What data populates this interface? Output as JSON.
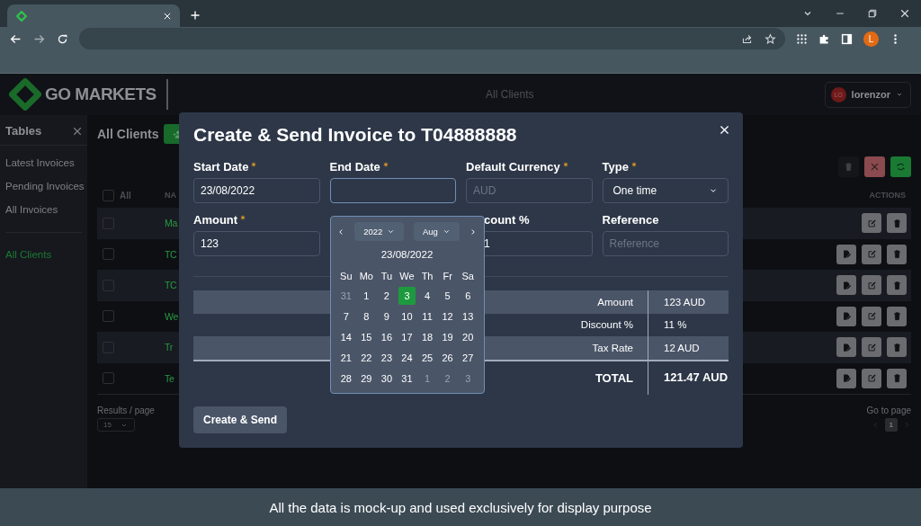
{
  "browser": {
    "profile_initial": "L"
  },
  "header": {
    "logo": "GO MARKETS",
    "title": "All Clients",
    "user": {
      "initials": "LO",
      "name": "lorenzor"
    }
  },
  "sidebar": {
    "title": "Tables",
    "sections": [
      {
        "items": [
          {
            "label": "Latest Invoices",
            "selected": false
          },
          {
            "label": "Pending Invoices",
            "selected": false
          },
          {
            "label": "All Invoices",
            "selected": false
          }
        ]
      },
      {
        "items": [
          {
            "label": "All Clients",
            "selected": true
          }
        ]
      }
    ]
  },
  "content": {
    "title": "All Clients",
    "select_all": "All",
    "select_all_checked": false,
    "columns": [
      "NA",
      "ACTIONS"
    ],
    "rows": [
      {
        "name": "Ma",
        "checked": false,
        "invoice_action": false
      },
      {
        "name": "TC",
        "checked": false,
        "invoice_action": true
      },
      {
        "name": "TC",
        "checked": false,
        "invoice_action": true
      },
      {
        "name": "We",
        "checked": false,
        "invoice_action": true
      },
      {
        "name": "Tr",
        "checked": false,
        "invoice_action": true
      },
      {
        "name": "Te",
        "checked": false,
        "invoice_action": true
      }
    ],
    "results_label": "Results / page",
    "page_size": "15",
    "go_to_label": "Go to page",
    "pages": [
      {
        "label": "1",
        "selected": true
      }
    ]
  },
  "modal": {
    "title": "Create & Send Invoice to T04888888",
    "fields": [
      {
        "kind": "input",
        "label": "Start Date",
        "required": true,
        "value": "23/08/2022",
        "focused": false
      },
      {
        "kind": "input",
        "label": "End Date",
        "required": true,
        "focused": true
      },
      {
        "kind": "input",
        "label": "Default Currency",
        "required": true,
        "placeholder": "AUD",
        "focused": false
      },
      {
        "kind": "select",
        "label": "Type",
        "required": true,
        "value": "One time",
        "focused": false
      },
      {
        "kind": "input",
        "label": "Amount",
        "required": true,
        "value": "123",
        "focused": false
      },
      {
        "kind": "hidden"
      },
      {
        "kind": "input",
        "label": "count %",
        "required": false,
        "value": "1",
        "focused": false,
        "covered": true
      },
      {
        "kind": "input",
        "label": "Reference",
        "required": false,
        "placeholder": "Reference",
        "focused": false
      }
    ],
    "summary": [
      {
        "kind": "row",
        "label": "Amount",
        "value": "123 AUD",
        "shaded": true
      },
      {
        "kind": "row",
        "label": "Discount %",
        "value": "11 %",
        "shaded": false
      },
      {
        "kind": "row",
        "label": "Tax Rate",
        "value": "12 AUD",
        "shaded": true
      },
      {
        "kind": "total",
        "label": "TOTAL",
        "value": "121.47 AUD",
        "shaded": false
      }
    ],
    "submit": "Create & Send",
    "datepicker": {
      "year": "2022",
      "month": "Aug",
      "heading": "23/08/2022",
      "weekdays": [
        "Su",
        "Mo",
        "Tu",
        "We",
        "Th",
        "Fr",
        "Sa"
      ],
      "days": [
        {
          "label": "31",
          "outside": true,
          "selected": false
        },
        {
          "label": "1",
          "outside": false,
          "selected": false
        },
        {
          "label": "2",
          "outside": false,
          "selected": false
        },
        {
          "label": "3",
          "outside": false,
          "selected": true
        },
        {
          "label": "4",
          "outside": false,
          "selected": false
        },
        {
          "label": "5",
          "outside": false,
          "selected": false
        },
        {
          "label": "6",
          "outside": false,
          "selected": false
        },
        {
          "label": "7",
          "outside": false,
          "selected": false
        },
        {
          "label": "8",
          "outside": false,
          "selected": false
        },
        {
          "label": "9",
          "outside": false,
          "selected": false
        },
        {
          "label": "10",
          "outside": false,
          "selected": false
        },
        {
          "label": "11",
          "outside": false,
          "selected": false
        },
        {
          "label": "12",
          "outside": false,
          "selected": false
        },
        {
          "label": "13",
          "outside": false,
          "selected": false
        },
        {
          "label": "14",
          "outside": false,
          "selected": false
        },
        {
          "label": "15",
          "outside": false,
          "selected": false
        },
        {
          "label": "16",
          "outside": false,
          "selected": false
        },
        {
          "label": "17",
          "outside": false,
          "selected": false
        },
        {
          "label": "18",
          "outside": false,
          "selected": false
        },
        {
          "label": "19",
          "outside": false,
          "selected": false
        },
        {
          "label": "20",
          "outside": false,
          "selected": false
        },
        {
          "label": "21",
          "outside": false,
          "selected": false
        },
        {
          "label": "22",
          "outside": false,
          "selected": false
        },
        {
          "label": "23",
          "outside": false,
          "selected": false
        },
        {
          "label": "24",
          "outside": false,
          "selected": false
        },
        {
          "label": "25",
          "outside": false,
          "selected": false
        },
        {
          "label": "26",
          "outside": false,
          "selected": false
        },
        {
          "label": "27",
          "outside": false,
          "selected": false
        },
        {
          "label": "28",
          "outside": false,
          "selected": false
        },
        {
          "label": "29",
          "outside": false,
          "selected": false
        },
        {
          "label": "30",
          "outside": false,
          "selected": false
        },
        {
          "label": "31",
          "outside": false,
          "selected": false
        },
        {
          "label": "1",
          "outside": true,
          "selected": false
        },
        {
          "label": "2",
          "outside": true,
          "selected": false
        },
        {
          "label": "3",
          "outside": true,
          "selected": false
        }
      ]
    }
  },
  "caption": "All the data is mock-up and used exclusively for display purpose"
}
